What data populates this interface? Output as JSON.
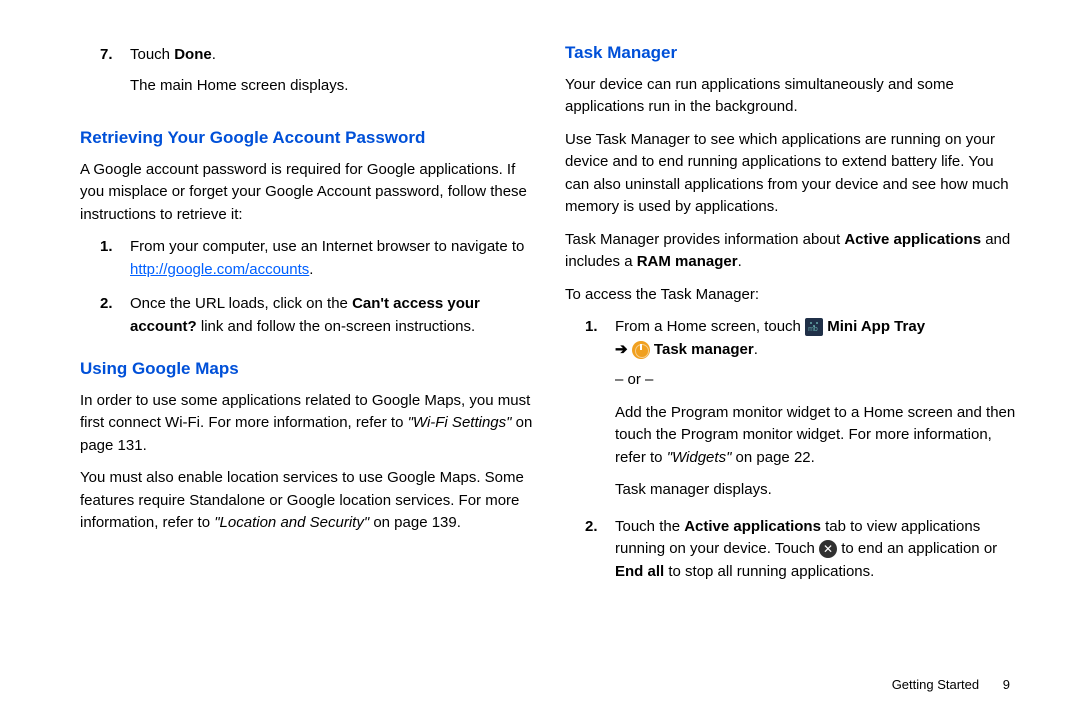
{
  "left": {
    "step7_num": "7.",
    "step7_a": "Touch ",
    "step7_b": "Done",
    "step7_c": ".",
    "step7_sub": "The main Home screen displays.",
    "h_retrieve": "Retrieving Your Google Account Password",
    "retrieve_intro": "A Google account password is required for Google applications. If you misplace or forget your Google Account password, follow these instructions to retrieve it:",
    "r1_num": "1.",
    "r1_a": "From your computer, use an Internet browser to navigate to ",
    "r1_link": "http://google.com/accounts",
    "r1_dot": ".",
    "r2_num": "2.",
    "r2_a": "Once the URL loads, click on the ",
    "r2_b": "Can't access your account?",
    "r2_c": " link and follow the on-screen instructions.",
    "h_maps": "Using Google Maps",
    "maps_p1_a": "In order to use some applications related to Google Maps, you must first connect Wi-Fi. For more information, refer to ",
    "maps_p1_i": "\"Wi-Fi Settings\"",
    "maps_p1_b": "  on page 131.",
    "maps_p2_a": "You must also enable location services to use Google Maps. Some features require Standalone or Google location services. For more information, refer to ",
    "maps_p2_i": "\"Location and Security\"",
    "maps_p2_b": "  on page 139."
  },
  "right": {
    "h_task": "Task Manager",
    "task_p1": "Your device can run applications simultaneously and some applications run in the background.",
    "task_p2": "Use Task Manager to see which applications are running on your device and to end running applications to extend battery life. You can also uninstall applications from your device and see how much memory is used by applications.",
    "task_p3_a": "Task Manager provides information about ",
    "task_p3_b": "Active applications",
    "task_p3_c": " and includes a ",
    "task_p3_d": "RAM manager",
    "task_p3_e": ".",
    "task_access": "To access the Task Manager:",
    "t1_num": "1.",
    "t1_a": "From a Home screen, touch ",
    "t1_b": " Mini App Tray",
    "t1_arrow": " ➔ ",
    "t1_c": " Task manager",
    "t1_d": ".",
    "t1_or": "– or –",
    "t1_p2_a": "Add the Program monitor widget to a Home screen and then touch the Program monitor widget. For more information, refer to ",
    "t1_p2_i": "\"Widgets\"",
    "t1_p2_b": "  on page 22.",
    "t1_p3": "Task manager displays.",
    "t2_num": "2.",
    "t2_a": "Touch the ",
    "t2_b": "Active applications",
    "t2_c": " tab to view applications running on your device. Touch ",
    "t2_d": " to end an application or ",
    "t2_e": "End all",
    "t2_f": " to stop all running applications."
  },
  "footer": {
    "section": "Getting Started",
    "page": "9"
  }
}
